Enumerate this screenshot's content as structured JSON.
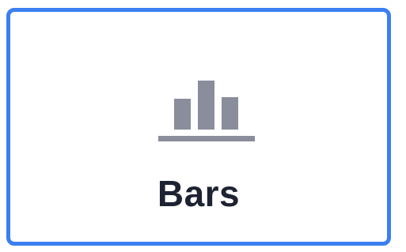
{
  "card": {
    "label": "Bars",
    "icon": "bar-chart-icon",
    "selected": true
  },
  "colors": {
    "selected_border": "#3b7ff0",
    "icon": "#8a8d9c",
    "label_text": "#1e2333",
    "background": "#ffffff"
  }
}
